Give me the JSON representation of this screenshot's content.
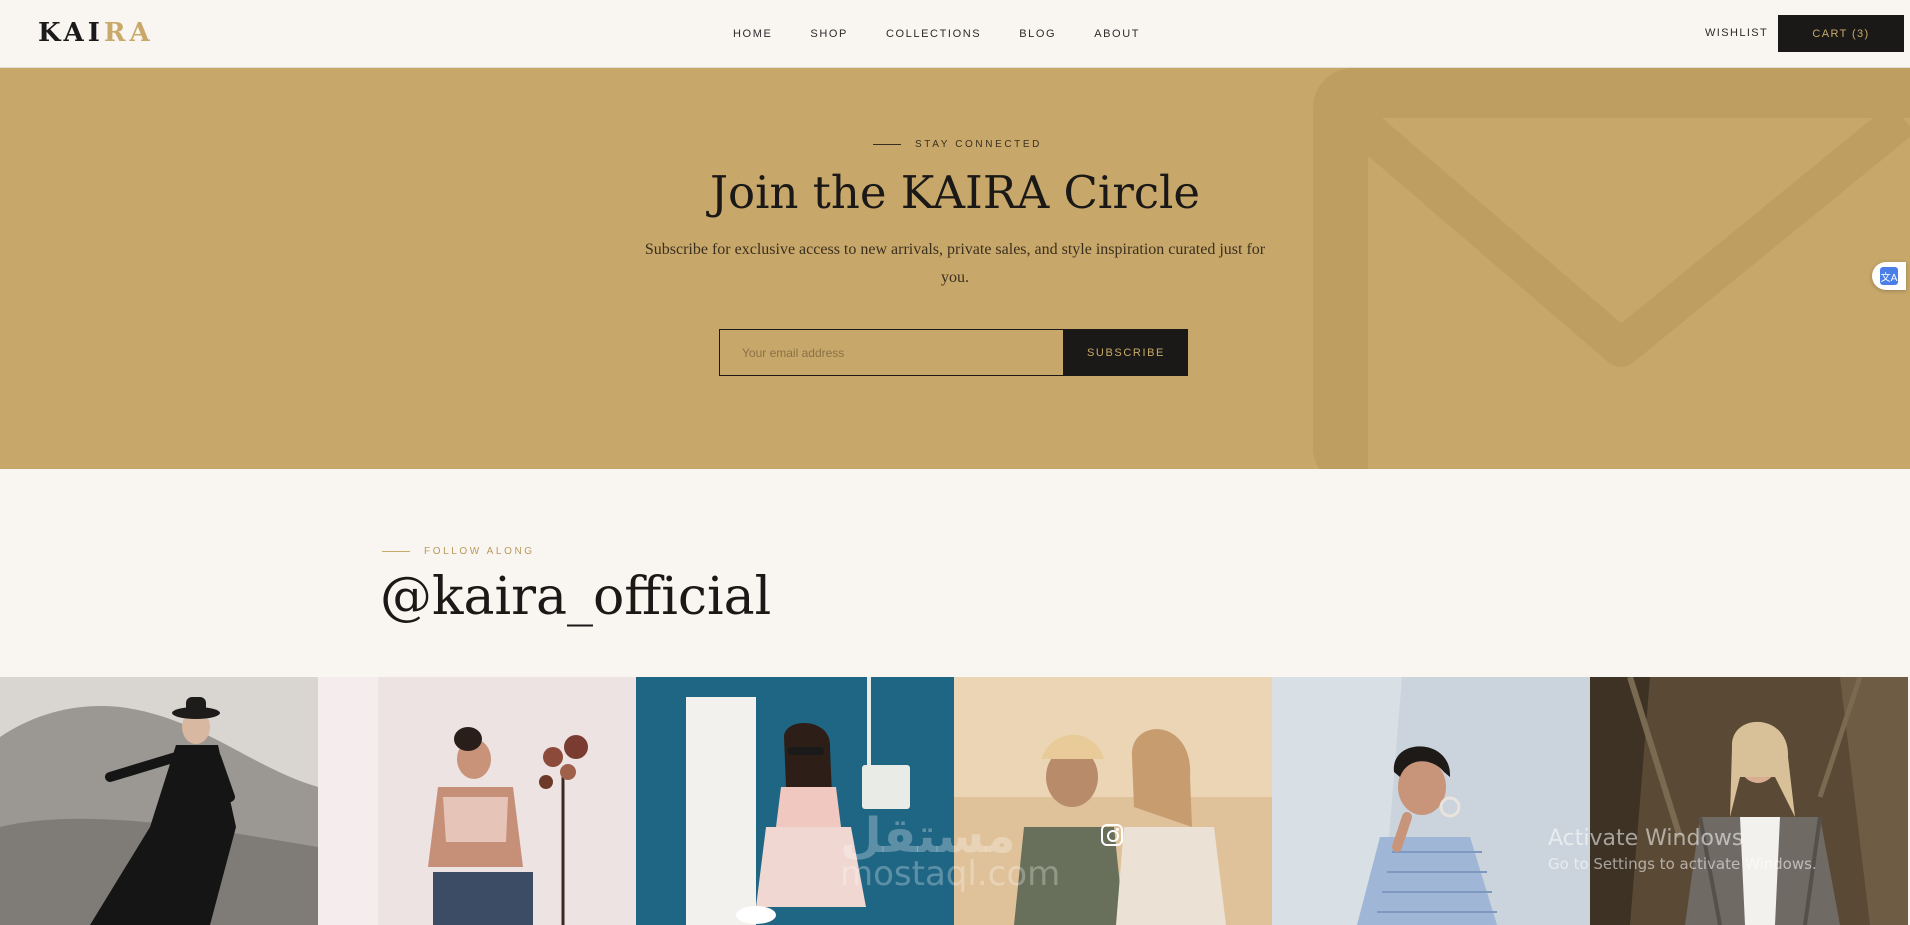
{
  "header": {
    "logo_main": "KAI",
    "logo_accent": "RA",
    "nav": [
      "HOME",
      "SHOP",
      "COLLECTIONS",
      "BLOG",
      "ABOUT"
    ],
    "wishlist": "WISHLIST",
    "cart": "CART (3)"
  },
  "newsletter": {
    "eyebrow": "STAY CONNECTED",
    "title": "Join the KAIRA Circle",
    "subtitle": "Subscribe for exclusive access to new arrivals, private sales, and style inspiration curated just for you.",
    "email_placeholder": "Your email address",
    "subscribe_label": "SUBSCRIBE",
    "background_icon": "envelope-icon",
    "colors": {
      "background": "#c8a86a",
      "accent": "#c8a96a",
      "dark": "#1b1917"
    }
  },
  "translate_widget": {
    "label": "文A"
  },
  "follow": {
    "eyebrow": "FOLLOW ALONG",
    "handle": "@kaira_official",
    "hover_icon": "instagram-icon"
  },
  "gallery": [
    {
      "name": "photo-woman-black-dress-hat"
    },
    {
      "name": "photo-woman-crop-top-flowers"
    },
    {
      "name": "photo-woman-sunglasses-blue-wall"
    },
    {
      "name": "photo-two-friends-sunlight"
    },
    {
      "name": "photo-woman-striped-shirt"
    },
    {
      "name": "photo-woman-tweed-blazer"
    }
  ],
  "overlays": {
    "activate_title": "Activate Windows",
    "activate_sub": "Go to Settings to activate Windows.",
    "watermark_ar": "مستقل",
    "watermark_en": "mostaql.com"
  }
}
